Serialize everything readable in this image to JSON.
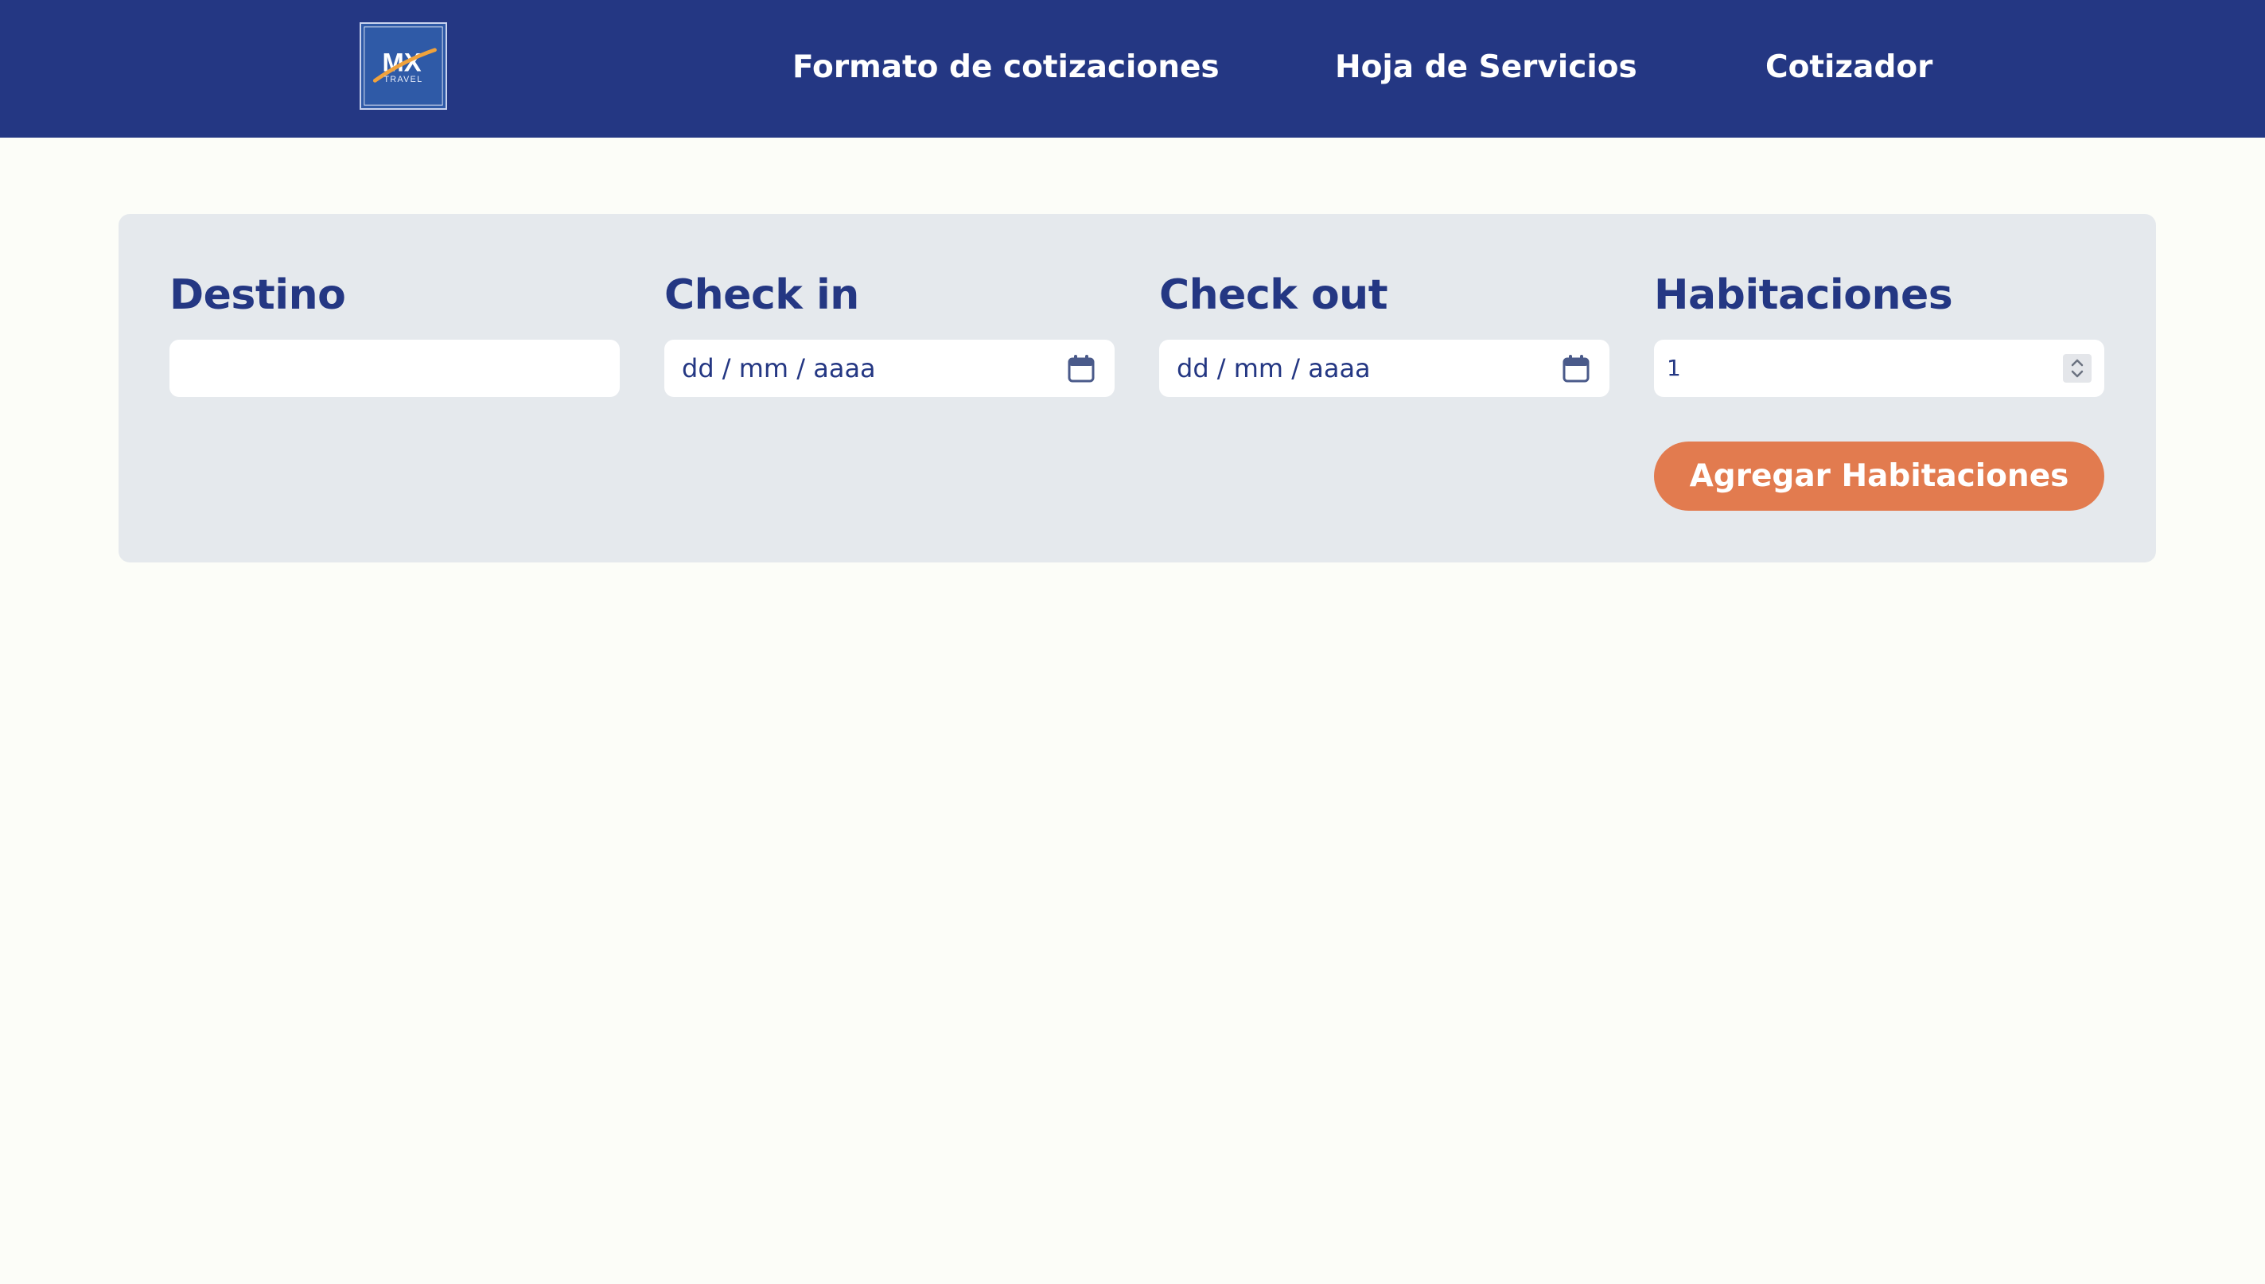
{
  "header": {
    "logo": {
      "main_text": "MX",
      "sub_text": "TRAVEL",
      "alt": "MX Travel logo"
    },
    "nav": [
      {
        "label": "Formato de cotizaciones"
      },
      {
        "label": "Hoja de Servicios"
      },
      {
        "label": "Cotizador"
      }
    ]
  },
  "form": {
    "destino": {
      "label": "Destino",
      "value": ""
    },
    "check_in": {
      "label": "Check in",
      "placeholder": "dd / mm / aaaa",
      "icon": "calendar-icon"
    },
    "check_out": {
      "label": "Check out",
      "placeholder": "dd / mm / aaaa",
      "icon": "calendar-icon"
    },
    "habitaciones": {
      "label": "Habitaciones",
      "value": "1"
    },
    "add_button_label": "Agregar Habitaciones"
  },
  "colors": {
    "navbar": "#243783",
    "page_background": "#fcfdf8",
    "panel_background": "#e5e9ed",
    "label_text": "#243783",
    "button": "#e27b4f",
    "logo_accent": "#f0a23c"
  }
}
